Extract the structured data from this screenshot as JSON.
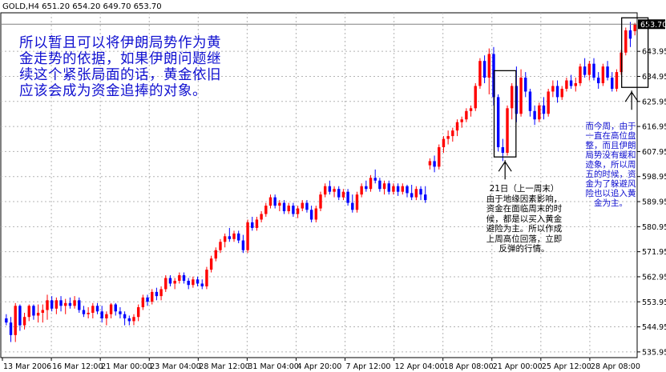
{
  "chart_data": {
    "type": "candlestick",
    "symbol": "GOLD,H4",
    "header_values": "651.20 654.20 649.70 653.70",
    "ylim": [
      533.9,
      657.8
    ],
    "y_ticks": [
      "653.70",
      "643.95",
      "634.95",
      "625.95",
      "616.95",
      "607.95",
      "598.95",
      "589.95",
      "580.95",
      "571.95",
      "562.95",
      "553.95",
      "544.95",
      "535.95"
    ],
    "x_ticks": [
      "13 Mar 2006",
      "16 Mar 12:00",
      "21 Mar 00:00",
      "23 Mar 04:00",
      "28 Mar 12:00",
      "31 Mar 04:00",
      "4 Apr 20:00",
      "7 Apr 12:00",
      "12 Apr 04:00",
      "18 Apr 08:00",
      "21 Apr 00:00",
      "25 Apr 12:00",
      "28 Apr 08:00"
    ],
    "current_price": "653.70",
    "bull_color": "#ff0000",
    "bear_color": "#0000ff",
    "ohlc": [
      [
        548,
        549.5,
        545.5,
        546.5
      ],
      [
        546.5,
        548.5,
        539.5,
        542
      ],
      [
        542,
        553.5,
        539.5,
        552.5
      ],
      [
        552.5,
        553,
        543.5,
        545.5
      ],
      [
        545.5,
        550,
        544,
        548.5
      ],
      [
        548.5,
        553,
        547,
        552.5
      ],
      [
        552.5,
        553,
        547.5,
        549
      ],
      [
        549,
        553,
        546.5,
        550
      ],
      [
        550,
        553,
        546.5,
        551
      ],
      [
        551,
        556.5,
        547.5,
        554.5
      ],
      [
        554.5,
        556,
        550.5,
        551.5
      ],
      [
        551.5,
        555.5,
        549.5,
        554.5
      ],
      [
        554.5,
        556,
        550.5,
        552.5
      ],
      [
        552.5,
        555,
        549.5,
        553.5
      ],
      [
        553.5,
        555.5,
        551.5,
        552.5
      ],
      [
        552.5,
        556,
        551.5,
        554.5
      ],
      [
        554.5,
        555.5,
        550,
        551
      ],
      [
        551,
        552.5,
        548.5,
        549.5
      ],
      [
        549.5,
        552,
        548,
        550
      ],
      [
        550,
        553.5,
        548,
        552.5
      ],
      [
        552.5,
        553.5,
        549.5,
        550.5
      ],
      [
        550.5,
        552.5,
        546.5,
        548
      ],
      [
        548,
        550.5,
        545.5,
        549.5
      ],
      [
        549.5,
        553.5,
        548,
        553
      ],
      [
        553,
        553.5,
        549,
        550.5
      ],
      [
        550.5,
        552,
        548,
        549.5
      ],
      [
        549.5,
        550.5,
        545.5,
        548
      ],
      [
        548,
        549,
        545.5,
        547
      ],
      [
        547,
        549.5,
        545.5,
        548.5
      ],
      [
        548.5,
        553,
        547,
        552
      ],
      [
        552,
        556.5,
        551,
        555.5
      ],
      [
        555.5,
        556.5,
        552.5,
        554
      ],
      [
        554,
        558.5,
        553,
        557.5
      ],
      [
        557.5,
        559,
        554.5,
        556
      ],
      [
        556,
        559.5,
        554.5,
        558.5
      ],
      [
        558.5,
        563.5,
        557.5,
        562.5
      ],
      [
        562.5,
        563.5,
        559.5,
        560.5
      ],
      [
        560.5,
        562.5,
        558.5,
        561.5
      ],
      [
        561.5,
        564.5,
        560.5,
        563.5
      ],
      [
        563.5,
        564.5,
        560.5,
        561.5
      ],
      [
        561.5,
        562.5,
        558.5,
        560
      ],
      [
        560,
        563,
        559,
        562
      ],
      [
        562,
        563,
        559.5,
        560.5
      ],
      [
        560.5,
        562,
        558.5,
        559.5
      ],
      [
        559.5,
        566.5,
        558.5,
        565.5
      ],
      [
        565.5,
        570.5,
        564.5,
        569.5
      ],
      [
        569.5,
        573.5,
        568.5,
        572.5
      ],
      [
        572.5,
        576.5,
        571.5,
        575.5
      ],
      [
        575.5,
        578.5,
        573.5,
        577.5
      ],
      [
        577.5,
        580.5,
        575.5,
        576.5
      ],
      [
        576.5,
        579.5,
        575.5,
        578.5
      ],
      [
        578.5,
        579.5,
        575,
        576
      ],
      [
        576,
        578,
        571.5,
        572.5
      ],
      [
        572.5,
        583.5,
        571.5,
        582.5
      ],
      [
        582.5,
        584.5,
        579.5,
        580.5
      ],
      [
        580.5,
        584.5,
        579.5,
        583.5
      ],
      [
        583.5,
        586.5,
        582.5,
        585.5
      ],
      [
        585.5,
        589.5,
        584.5,
        588.5
      ],
      [
        588.5,
        592.5,
        587.5,
        591.5
      ],
      [
        591.5,
        592.5,
        587.5,
        588.5
      ],
      [
        588.5,
        590.5,
        586.5,
        589.5
      ],
      [
        589.5,
        590.5,
        585.5,
        586.5
      ],
      [
        586.5,
        589.5,
        585.5,
        588.5
      ],
      [
        588.5,
        589.5,
        584.5,
        585.5
      ],
      [
        585.5,
        588.5,
        584,
        587.5
      ],
      [
        587.5,
        590.5,
        586.5,
        589.5
      ],
      [
        589.5,
        590.5,
        586,
        587
      ],
      [
        587,
        588.5,
        582.5,
        583.5
      ],
      [
        583.5,
        588.5,
        582.5,
        587.5
      ],
      [
        587.5,
        593.5,
        586.5,
        592.5
      ],
      [
        592.5,
        596.5,
        591.5,
        595.5
      ],
      [
        595.5,
        597.5,
        592.5,
        593.5
      ],
      [
        593.5,
        595.5,
        591.5,
        594.5
      ],
      [
        594.5,
        595.5,
        590.5,
        591.5
      ],
      [
        591.5,
        594.5,
        590.5,
        593.5
      ],
      [
        593.5,
        594.5,
        588.5,
        589.5
      ],
      [
        589.5,
        592.5,
        586,
        587
      ],
      [
        587,
        593.5,
        586,
        592.5
      ],
      [
        592.5,
        596.5,
        591.5,
        595.5
      ],
      [
        595.5,
        597.5,
        593.5,
        594.5
      ],
      [
        594.5,
        599.5,
        593.5,
        598.5
      ],
      [
        598.5,
        601.5,
        596.5,
        597.5
      ],
      [
        597.5,
        598.5,
        593.5,
        594.5
      ],
      [
        594.5,
        597.5,
        592.5,
        596.5
      ],
      [
        596.5,
        597.5,
        592.5,
        593.5
      ],
      [
        593.5,
        596.5,
        592.5,
        595.5
      ],
      [
        595.5,
        596.5,
        592,
        593.5
      ],
      [
        593.5,
        596.5,
        592.5,
        595.5
      ],
      [
        595.5,
        596,
        591.5,
        593
      ],
      [
        593,
        596,
        590.5,
        591.5
      ],
      [
        591.5,
        595.5,
        590.5,
        594.5
      ],
      [
        594.5,
        595.5,
        590.5,
        592.5
      ],
      [
        592.5,
        595.5,
        589.5,
        590.5
      ],
      [
        603,
        605.5,
        601.5,
        604.5
      ],
      [
        604.5,
        606.5,
        600.5,
        602.5
      ],
      [
        602.5,
        610.5,
        601.5,
        609.5
      ],
      [
        609.5,
        613.5,
        607.5,
        612.5
      ],
      [
        612.5,
        615.5,
        610.5,
        613.5
      ],
      [
        613.5,
        616.5,
        611.5,
        615.5
      ],
      [
        615.5,
        619.5,
        613.5,
        618.5
      ],
      [
        618.5,
        620.5,
        616.5,
        619.5
      ],
      [
        619.5,
        623.5,
        618.5,
        622.5
      ],
      [
        622.5,
        624.5,
        620.5,
        623.5
      ],
      [
        623.5,
        632.5,
        622.5,
        631.5
      ],
      [
        631.5,
        641.5,
        630.5,
        640.5
      ],
      [
        640.5,
        642.5,
        632.5,
        634.5
      ],
      [
        634.5,
        645,
        628.5,
        643
      ],
      [
        643,
        645.5,
        624.5,
        627.5
      ],
      [
        627.5,
        628.5,
        608,
        609.5
      ],
      [
        609.5,
        612.5,
        604.5,
        607.5
      ],
      [
        607.5,
        624.5,
        606.5,
        623.5
      ],
      [
        623.5,
        632.5,
        619.5,
        631.5
      ],
      [
        631.5,
        638.5,
        618.5,
        621.5
      ],
      [
        621.5,
        637.5,
        620.5,
        634.5
      ],
      [
        634.5,
        636.5,
        627.5,
        629.5
      ],
      [
        629.5,
        630.5,
        620.5,
        622.5
      ],
      [
        622.5,
        624.5,
        617.5,
        619.5
      ],
      [
        619.5,
        625.5,
        618.5,
        624.5
      ],
      [
        624.5,
        627.5,
        619.5,
        621.5
      ],
      [
        621.5,
        630.5,
        620.5,
        629.5
      ],
      [
        629.5,
        633.5,
        627.5,
        631.5
      ],
      [
        631.5,
        633.5,
        625.5,
        627.5
      ],
      [
        627.5,
        631.5,
        626.5,
        630.5
      ],
      [
        630.5,
        634.5,
        629.5,
        633.5
      ],
      [
        633.5,
        635.5,
        630.5,
        631.5
      ],
      [
        631.5,
        634.5,
        629.5,
        632.5
      ],
      [
        632.5,
        639.5,
        631.5,
        638.5
      ],
      [
        638.5,
        641.5,
        634.5,
        635.5
      ],
      [
        635.5,
        640.5,
        633.5,
        639.5
      ],
      [
        639.5,
        641.5,
        633.5,
        634.5
      ],
      [
        634.5,
        636.5,
        630.5,
        632.5
      ],
      [
        632.5,
        639.5,
        631.5,
        638.5
      ],
      [
        638.5,
        640.5,
        633.5,
        634.5
      ],
      [
        634.5,
        636.5,
        629.5,
        630.5
      ],
      [
        630.5,
        637.5,
        629.5,
        636.5
      ],
      [
        636.5,
        644.5,
        635.5,
        643.5
      ],
      [
        643.5,
        652.5,
        642.5,
        651.5
      ],
      [
        651.5,
        654.5,
        645.5,
        648.5
      ],
      [
        651.2,
        654.2,
        649.7,
        653.7
      ]
    ]
  },
  "annotations": {
    "left": "所以暂且可以将伊朗局势作为黄金走势的依据，如果伊朗问题继续这个紧张局面的话，黄金依旧应该会成为资金追捧的对象。",
    "middle": "21日（上一周末）由于地缘因素影响，资金在面临周末的时候，都是以买入黄金避险为主。所以作成上周高位回落，立即反弹的行情。",
    "right": "而今周，由于一直在高位盘整，而且伊朗局势没有缓和迹象，所以周五的时候，资金为了躲避风险也以追入黄金为主。"
  }
}
